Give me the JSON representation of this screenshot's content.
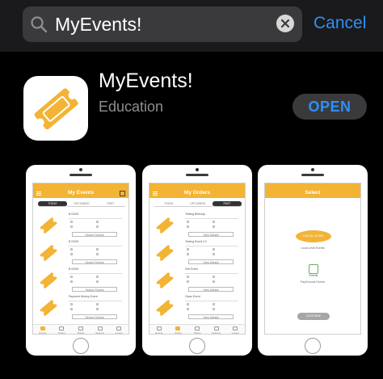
{
  "search": {
    "query": "MyEvents!",
    "cancel_label": "Cancel"
  },
  "app": {
    "name": "MyEvents!",
    "category": "Education",
    "action_label": "OPEN"
  },
  "colors": {
    "accent": "#2f8ff7",
    "brand": "#f3b334",
    "background": "#000000",
    "field": "#3a3a3d"
  },
  "screenshots": [
    {
      "title": "My Events",
      "tabs": [
        "TODAY",
        "UPCOMING",
        "PAST"
      ],
      "active_tab": 0,
      "events": [
        {
          "name": "B 03/05",
          "button": "Search Tickets"
        },
        {
          "name": "B 03/05",
          "button": "Search Tickets"
        },
        {
          "name": "B 03/05",
          "button": "Search Tickets"
        },
        {
          "name": "Payment History Event",
          "button": "Search Tickets"
        }
      ],
      "nav": [
        "Events",
        "Orders",
        "Tickets",
        "Settings",
        "Logout"
      ],
      "nav_active": 0
    },
    {
      "title": "My Orders",
      "tabs": [
        "TODAY",
        "UPCOMING",
        "PAST"
      ],
      "active_tab": 2,
      "events": [
        {
          "name": "Testing Birthday",
          "button": "View Details"
        },
        {
          "name": "Testing Event 2.0",
          "button": "View Details"
        },
        {
          "name": "Fall Event",
          "button": "View Details"
        },
        {
          "name": "Class Event",
          "button": "View Details"
        }
      ],
      "nav": [
        "Events",
        "Orders",
        "Tickets",
        "Settings",
        "Logout"
      ],
      "nav_active": 1
    },
    {
      "title": "Select",
      "logo1_text": "LOCAL LEVEL",
      "option1": "Local Level Events",
      "logo2_text": "Events",
      "option2": "PaySchools Events",
      "continue_label": "CONTINUE"
    }
  ]
}
